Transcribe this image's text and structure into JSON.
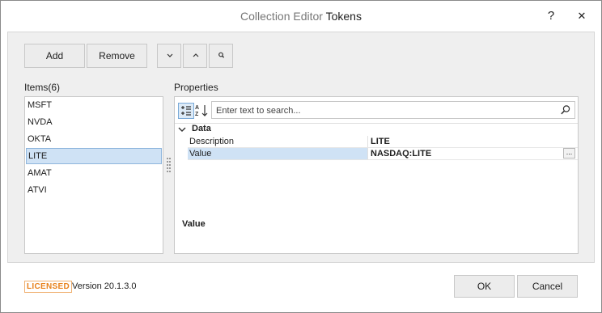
{
  "window": {
    "title_prefix": "Collection Editor",
    "title_suffix": "Tokens",
    "help_label": "?",
    "close_label": "✕"
  },
  "toolbar": {
    "add_label": "Add",
    "remove_label": "Remove",
    "move_down_label": "⌄",
    "move_up_label": "⌃",
    "search_label": "🔍"
  },
  "items": {
    "header": "Items(6)",
    "list": [
      "MSFT",
      "NVDA",
      "OKTA",
      "LITE",
      "AMAT",
      "ATVI"
    ],
    "selected_index": 3
  },
  "properties": {
    "header": "Properties",
    "search_placeholder": "Enter text to search...",
    "icons": [
      "categorized-icon",
      "alphabetical-sort-icon",
      "search-icon"
    ],
    "category": {
      "name": "Data",
      "expanded": true,
      "rows": [
        {
          "name": "Description",
          "value": "LITE",
          "selected": false
        },
        {
          "name": "Value",
          "value": "NASDAQ:LITE",
          "selected": true,
          "has_ellipsis": true
        }
      ]
    },
    "ellipsis_label": "...",
    "description_title": "Value"
  },
  "footer": {
    "licensed_label": "LICENSED",
    "version_text": "Version 20.1.3.0",
    "ok_label": "OK",
    "cancel_label": "Cancel"
  },
  "colors": {
    "selection": "#cfe2f5",
    "licensed": "#e8821c"
  }
}
